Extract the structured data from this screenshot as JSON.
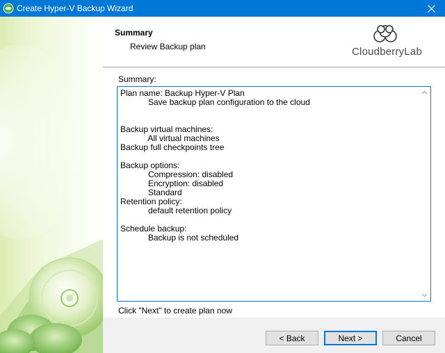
{
  "window": {
    "title": "Create Hyper-V Backup Wizard",
    "icon": "globe-app-icon",
    "close_glyph": "✕"
  },
  "header": {
    "title": "Summary",
    "subtitle": "Review Backup plan",
    "logo_text": "CloudberryLab"
  },
  "content": {
    "summary_label": "Summary:",
    "summary_lines": [
      "Plan name: Backup Hyper-V Plan",
      "            Save backup plan configuration to the cloud",
      "",
      "",
      "Backup virtual machines:",
      "            All virtual machines",
      "Backup full checkpoints tree",
      "",
      "Backup options:",
      "            Compression: disabled",
      "            Encryption: disabled",
      "            Standard",
      "Retention policy:",
      "            default retention policy",
      "",
      "Schedule backup:",
      "            Backup is not scheduled"
    ],
    "status_text": "Click \"Next\" to create plan now"
  },
  "buttons": {
    "back": "< Back",
    "next": "Next >",
    "cancel": "Cancel"
  },
  "colors": {
    "titlebar": "#0078d7",
    "accent": "#0078d7"
  }
}
